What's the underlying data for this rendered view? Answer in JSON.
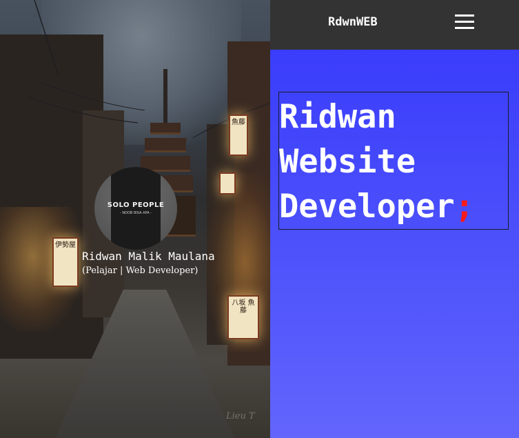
{
  "navbar": {
    "brand": "RdwnWEB",
    "menu_icon": "hamburger-icon"
  },
  "profile": {
    "name": "Ridwan Malik Maulana",
    "role": "(Pelajar | Web Developer)",
    "avatar_text": "SOLO PEOPLE",
    "avatar_subtext": "- NOOB BISA APA -"
  },
  "hero": {
    "line1": "Ridwan",
    "line2": "Website",
    "line3": "Developer",
    "accent": ";"
  },
  "background": {
    "watermark": "Lieu T",
    "lantern_1": "魚藤",
    "lantern_2": "伊勢屋",
    "lantern_3": "八坂 魚藤"
  },
  "colors": {
    "navbar": "#333333",
    "content_top": "#3a3dfb",
    "content_bottom": "#6365fd",
    "accent": "#ff1a1a"
  }
}
